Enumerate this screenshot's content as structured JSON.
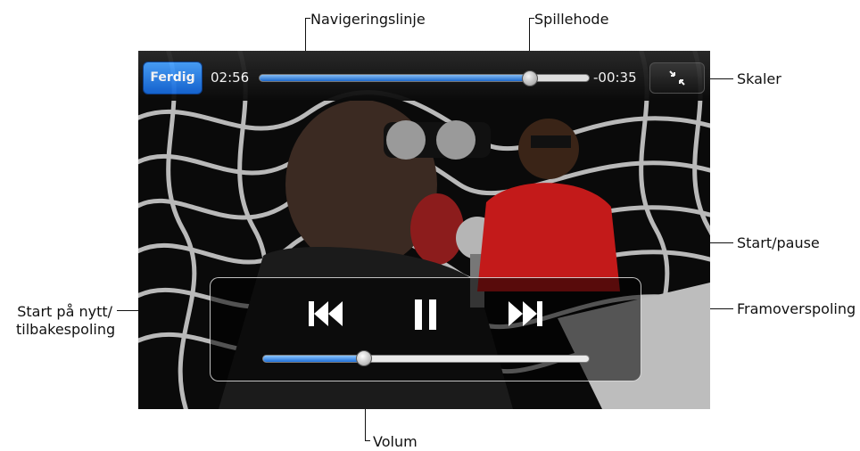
{
  "player": {
    "done_label": "Ferdig",
    "elapsed": "02:56",
    "remaining": "-00:35",
    "progress": 0.82,
    "volume": 0.31,
    "accent_color": "#2b7de9"
  },
  "callouts": {
    "scrubber_bar": "Navigeringslinje",
    "playhead": "Spillehode",
    "scale": "Skaler",
    "play_pause": "Start/pause",
    "restart_rewind_line1": "Start på nytt/",
    "restart_rewind_line2": "tilbakespoling",
    "fast_forward": "Framoverspoling",
    "volume": "Volum"
  },
  "icons": {
    "scale": "scale-icon",
    "previous": "previous-track-icon",
    "pause": "pause-icon",
    "next": "next-track-icon"
  }
}
